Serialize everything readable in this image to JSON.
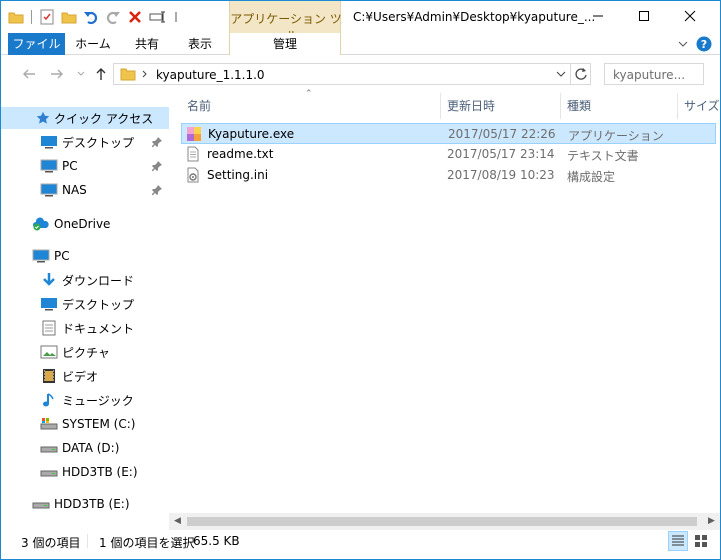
{
  "window": {
    "title": "C:¥Users¥Admin¥Desktop¥kyaputure_...",
    "context_group_label": "アプリケーション ツール"
  },
  "ribbon": {
    "tabs": [
      {
        "label": "ファイル"
      },
      {
        "label": "ホーム"
      },
      {
        "label": "共有"
      },
      {
        "label": "表示"
      },
      {
        "label": "管理"
      }
    ]
  },
  "address": {
    "path": "kyaputure_1.1.1.0",
    "search_placeholder": "kyaputure..."
  },
  "nav": {
    "items": [
      {
        "label": "クイック アクセス",
        "icon": "star-icon"
      },
      {
        "label": "デスクトップ",
        "icon": "desktop-icon",
        "pinned": true
      },
      {
        "label": "PC",
        "icon": "pc-icon",
        "pinned": true
      },
      {
        "label": "NAS",
        "icon": "pc-icon",
        "pinned": true
      },
      {
        "label": "OneDrive",
        "icon": "onedrive-icon"
      },
      {
        "label": "PC",
        "icon": "pc-icon"
      },
      {
        "label": "ダウンロード",
        "icon": "download-icon"
      },
      {
        "label": "デスクトップ",
        "icon": "desktop-icon"
      },
      {
        "label": "ドキュメント",
        "icon": "document-icon"
      },
      {
        "label": "ピクチャ",
        "icon": "picture-icon"
      },
      {
        "label": "ビデオ",
        "icon": "video-icon"
      },
      {
        "label": "ミュージック",
        "icon": "music-icon"
      },
      {
        "label": "SYSTEM (C:)",
        "icon": "system-drive-icon"
      },
      {
        "label": "DATA (D:)",
        "icon": "drive-icon"
      },
      {
        "label": "HDD3TB (E:)",
        "icon": "drive-icon"
      },
      {
        "label": "HDD3TB (E:)",
        "icon": "drive-icon"
      }
    ]
  },
  "columns": {
    "name": "名前",
    "date": "更新日時",
    "type": "種類",
    "size": "サイズ"
  },
  "files": [
    {
      "name": "Kyaputure.exe",
      "date": "2017/05/17 22:26",
      "type": "アプリケーション",
      "icon": "exe-icon",
      "selected": true
    },
    {
      "name": "readme.txt",
      "date": "2017/05/17 23:14",
      "type": "テキスト文書",
      "icon": "text-file-icon",
      "selected": false
    },
    {
      "name": "Setting.ini",
      "date": "2017/08/19 10:23",
      "type": "構成設定",
      "icon": "settings-file-icon",
      "selected": false
    }
  ],
  "status": {
    "count": "3 個の項目",
    "selection": "1 個の項目を選択",
    "size": "65.5 KB"
  },
  "colors": {
    "accent": "#1979ca",
    "selection": "#cce8ff",
    "context_tab": "#f3e6c7"
  }
}
